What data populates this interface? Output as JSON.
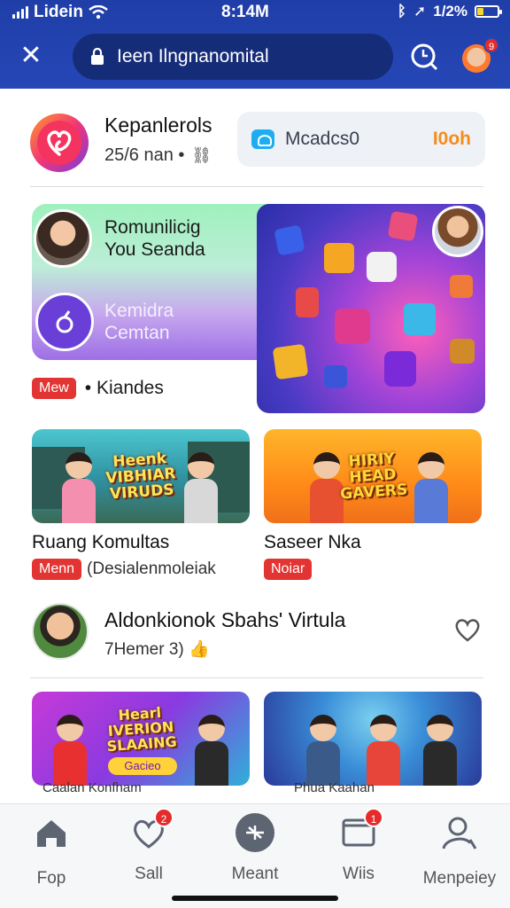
{
  "status_bar": {
    "carrier": "Lidein",
    "time": "8:14M",
    "battery": "1/2%"
  },
  "header": {
    "url_text": "Ieen Ilngnanomital",
    "avatar_badge": "9"
  },
  "profile": {
    "name": "Kepanlerols",
    "meta": "25/6 nan •",
    "follow_pill": {
      "label": "Mcadcs0",
      "action": "I0oh"
    }
  },
  "hero": {
    "title1": "Romunilicig\nYou Seanda",
    "title2": "Kemidra\nCemtan",
    "badge": "Mew",
    "tag": "• Kiandes"
  },
  "cards": [
    {
      "banner": "Heenk\nVIBHIAR\nVIRUDS",
      "title": "Ruang Komultas",
      "badge": "Menn",
      "meta": "(Desialenmoleiak"
    },
    {
      "banner": "HIRIY\nHEAD\nGAVERS",
      "title": "Saseer Nka",
      "badge": "Noiar",
      "meta": ""
    }
  ],
  "post": {
    "title": "Aldonkionok Sbahs' Virtula",
    "sub": "7Hemer 3)"
  },
  "row2": [
    {
      "banner": "Hearl\nIVERION\nSLAAING",
      "pill": "Gacieo",
      "peek": "Caalan Konfham"
    },
    {
      "peek": "Phua Kaahan"
    }
  ],
  "nav": [
    {
      "label": "Fop",
      "badge": ""
    },
    {
      "label": "Sall",
      "badge": "2"
    },
    {
      "label": "Meant",
      "badge": ""
    },
    {
      "label": "Wiis",
      "badge": "1"
    },
    {
      "label": "Menpeiey",
      "badge": ""
    }
  ],
  "colors": {
    "header": "#2547b6",
    "badge_red": "#e23533",
    "accent_orange": "#f58c1a"
  }
}
